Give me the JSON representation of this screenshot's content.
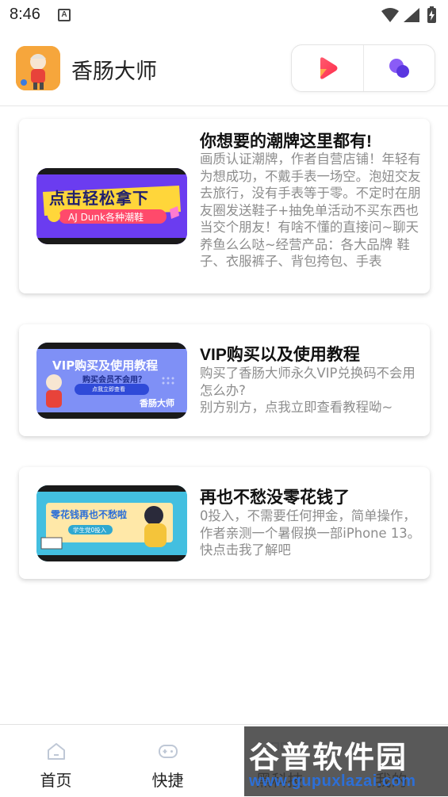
{
  "status_bar": {
    "time": "8:46",
    "notification_badge": "A",
    "icons": [
      "wifi-icon",
      "signal-icon",
      "battery-charging-icon"
    ]
  },
  "header": {
    "title": "香肠大师",
    "logo_icon": "app-logo",
    "capsule_buttons": [
      "play-video-icon",
      "bubbles-icon"
    ]
  },
  "cards": [
    {
      "title": "你想要的潮牌这里都有!",
      "description": "画质认证潮牌，作者自营店铺！年轻有为想成功，不戴手表一场空。泡妞交友去旅行，没有手表等于零。不定时在朋友圈发送鞋子+抽免单活动不买东西也当交个朋友！有啥不懂的直接问~聊天养鱼么么哒~经营产品：各大品牌 鞋子、衣服裤子、背包挎包、手表",
      "banner_main": "点击轻松拿下",
      "banner_sub": "AJ Dunk各种潮鞋"
    },
    {
      "title": "VIP购买以及使用教程",
      "description": "购买了香肠大师永久VIP兑换码不会用怎么办?\n别方别方，点我立即查看教程呦~",
      "banner_main": "VIP购买及使用教程",
      "banner_sub": "购买会员不会用？",
      "banner_btn": "点我立即查看",
      "banner_brand": "香肠大师"
    },
    {
      "title": "再也不愁没零花钱了",
      "description": "0投入，不需要任何押金，简单操作，作者亲测一个暑假换一部iPhone 13。快点击我了解吧",
      "banner_main": "零花钱再也不愁啦",
      "banner_sub": "学生党0投入"
    }
  ],
  "tabbar": {
    "items": [
      {
        "label": "首页",
        "icon": "home-icon"
      },
      {
        "label": "快捷",
        "icon": "gamepad-icon"
      },
      {
        "label": "黑科技",
        "icon": "grid-icon"
      },
      {
        "label": "我的",
        "icon": "user-icon"
      }
    ]
  },
  "watermark": {
    "line1": "谷普软件园",
    "line2": "www.gupuxlazai.com"
  },
  "colors": {
    "accent_red": "#f5384d",
    "accent_purple": "#6a4bf2",
    "text_muted": "#8d8d8d"
  }
}
